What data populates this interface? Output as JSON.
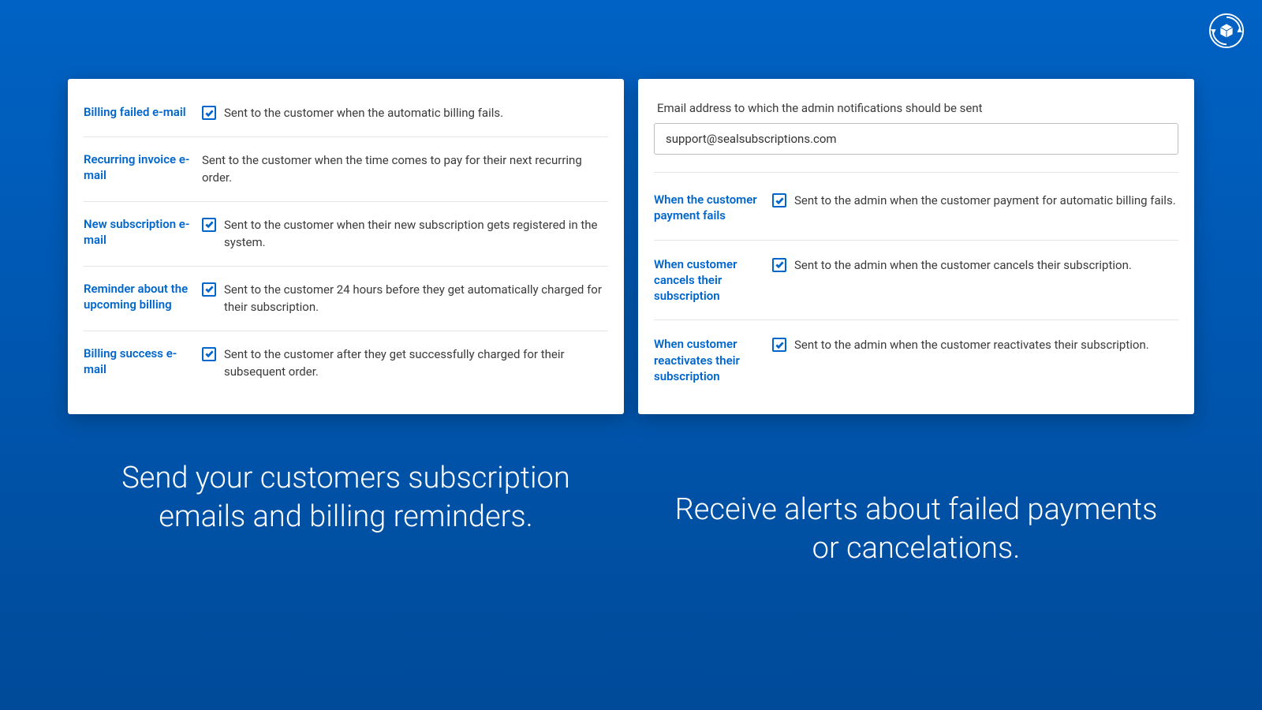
{
  "customerEmails": [
    {
      "label": "Billing failed e-mail",
      "checked": true,
      "desc": "Sent to the customer when the automatic billing fails."
    },
    {
      "label": "Recurring invoice e-mail",
      "checked": false,
      "desc": "Sent to the customer when the time comes to pay for their next recurring order."
    },
    {
      "label": "New subscription e-mail",
      "checked": true,
      "desc": "Sent to the customer when their new subscription gets registered in the system."
    },
    {
      "label": "Reminder about the upcoming billing",
      "checked": true,
      "desc": "Sent to the customer 24 hours before they get automatically charged for their subscription."
    },
    {
      "label": "Billing success e-mail",
      "checked": true,
      "desc": "Sent to the customer after they get successfully charged for their subsequent order."
    }
  ],
  "adminSection": {
    "label": "Email address to which the admin notifications should be sent",
    "email": "support@sealsubscriptions.com"
  },
  "adminEmails": [
    {
      "label": "When the customer payment fails",
      "checked": true,
      "desc": "Sent to the admin when the customer payment for automatic billing fails."
    },
    {
      "label": "When customer cancels their subscription",
      "checked": true,
      "desc": "Sent to the admin when the customer cancels their subscription."
    },
    {
      "label": "When customer reactivates their subscription",
      "checked": true,
      "desc": "Sent to the admin when the customer reactivates their subscription."
    }
  ],
  "captions": {
    "left": "Send your customers subscription emails and billing reminders.",
    "right": "Receive alerts about failed payments or cancelations."
  }
}
